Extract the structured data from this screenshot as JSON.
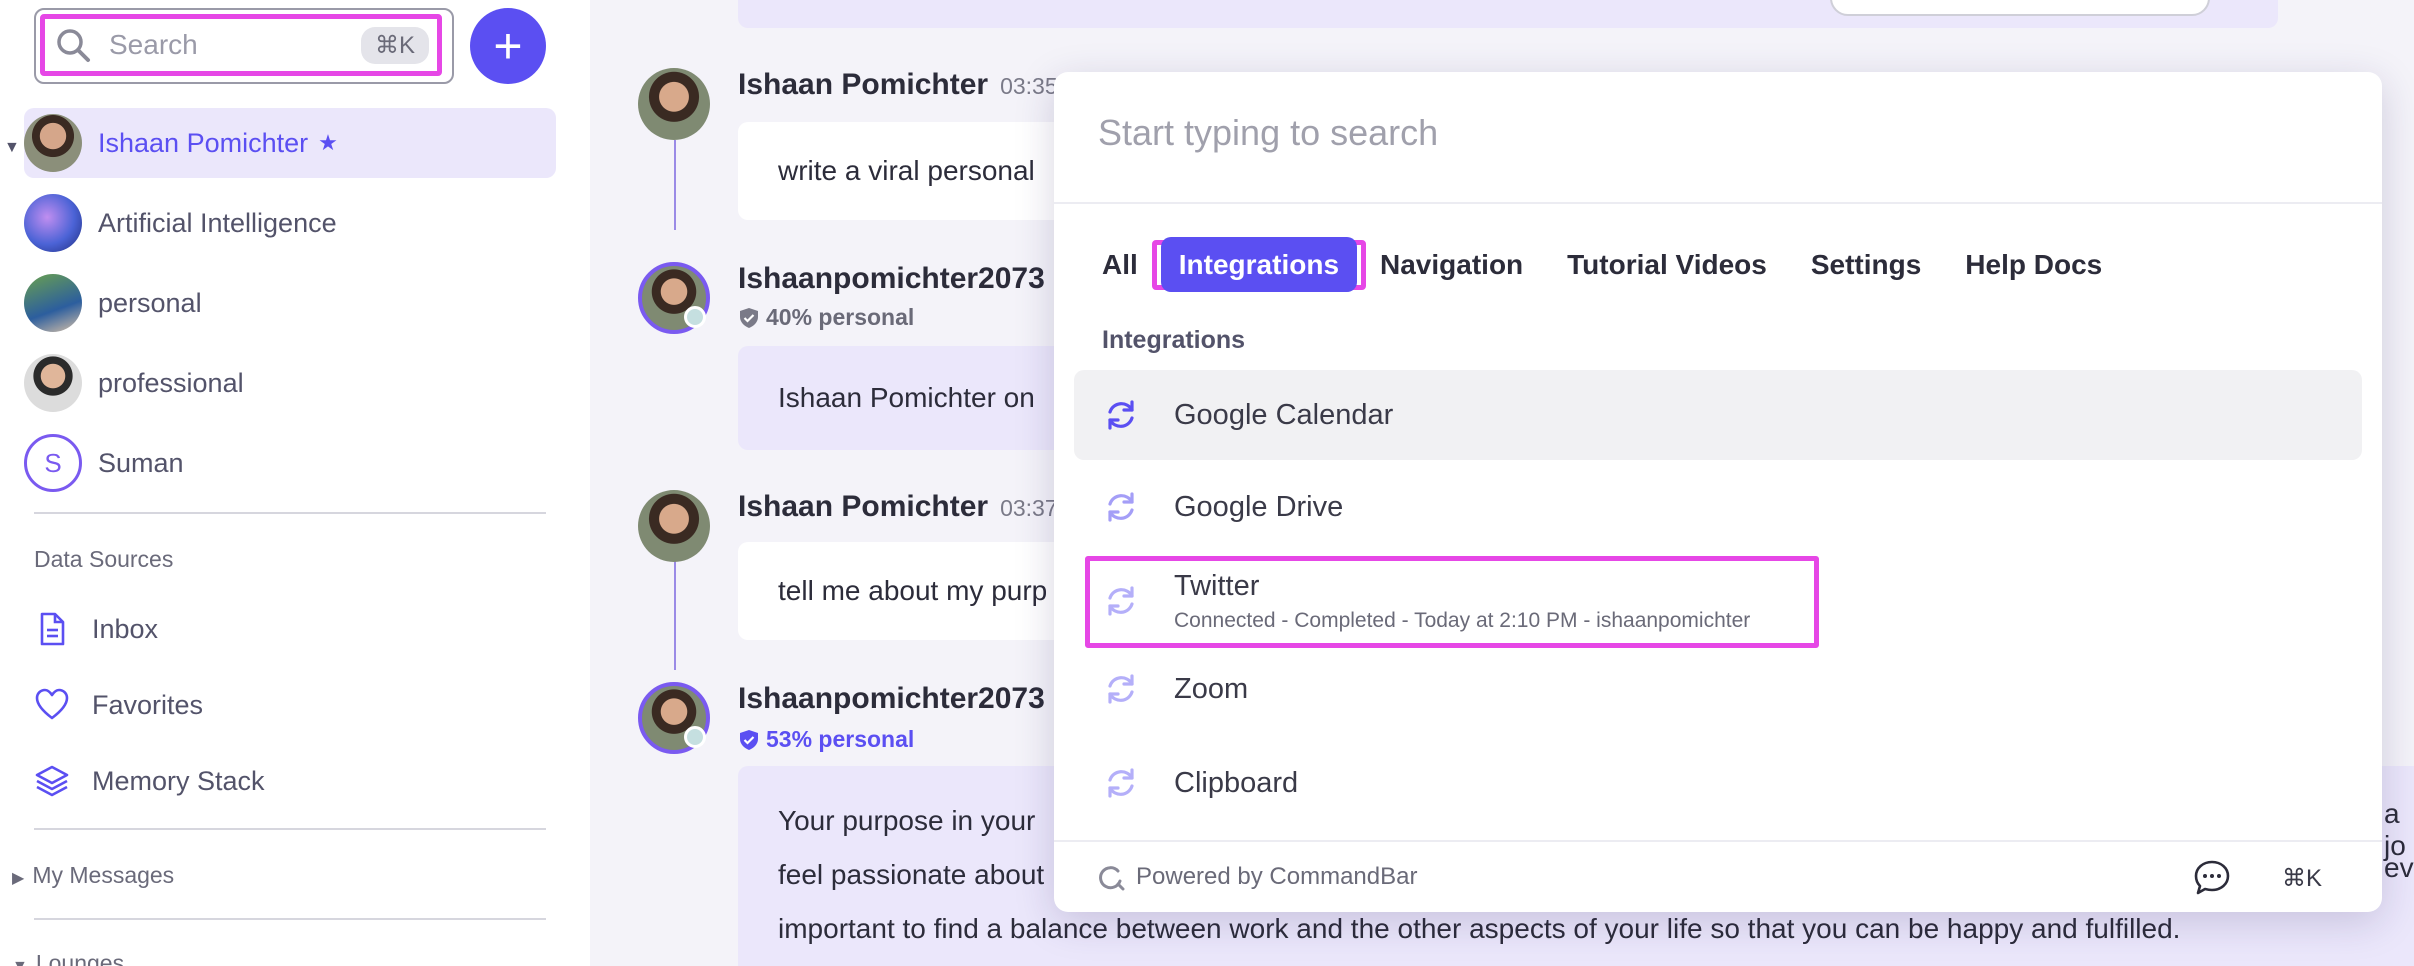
{
  "sidebar": {
    "search": {
      "placeholder": "Search",
      "shortcut": "⌘K"
    },
    "add_label": "+",
    "spaces": [
      {
        "label": "Ishaan Pomichter",
        "starred": true
      },
      {
        "label": "Artificial Intelligence"
      },
      {
        "label": "personal"
      },
      {
        "label": "professional"
      },
      {
        "label": "Suman",
        "initial": "S"
      }
    ],
    "data_sources_label": "Data Sources",
    "data_sources": [
      {
        "label": "Inbox",
        "icon": "document-icon"
      },
      {
        "label": "Favorites",
        "icon": "heart-icon"
      },
      {
        "label": "Memory Stack",
        "icon": "layers-icon"
      }
    ],
    "my_messages_label": "My Messages",
    "lounges_label": "Lounges"
  },
  "chat": {
    "messages": [
      {
        "author": "Ishaan Pomichter",
        "time": "03:35",
        "text": "write a viral personal"
      },
      {
        "author": "Ishaanpomichter2073",
        "badge": "40% personal",
        "text": "Ishaan Pomichter on"
      },
      {
        "author": "Ishaan Pomichter",
        "time": "03:37",
        "text": "tell me about my purp"
      },
      {
        "author": "Ishaanpomichter2073",
        "badge": "53% personal",
        "lines": [
          "Your purpose in your",
          "feel passionate about",
          "important to find a balance between work and the other aspects of your life so that you can be happy and fulfilled."
        ],
        "right_fragments": [
          "a jo",
          "eve"
        ]
      }
    ]
  },
  "commandbar": {
    "input_placeholder": "Start typing to search",
    "tabs": [
      "All",
      "Integrations",
      "Navigation",
      "Tutorial Videos",
      "Settings",
      "Help Docs"
    ],
    "active_tab": "Integrations",
    "group_label": "Integrations",
    "items": [
      {
        "title": "Google Calendar",
        "icon": "sync-icon"
      },
      {
        "title": "Google Drive",
        "icon": "sync-icon"
      },
      {
        "title": "Twitter",
        "subtitle": "Connected - Completed - Today at 2:10 PM - ishaanpomichter",
        "icon": "sync-icon"
      },
      {
        "title": "Zoom",
        "icon": "sync-icon"
      },
      {
        "title": "Clipboard",
        "icon": "sync-icon"
      }
    ],
    "footer": {
      "powered_by": "Powered by CommandBar",
      "shortcut": "⌘K"
    }
  },
  "colors": {
    "accent": "#5b4ff2",
    "highlight": "#e647e6",
    "tint": "#ebe7fb"
  }
}
